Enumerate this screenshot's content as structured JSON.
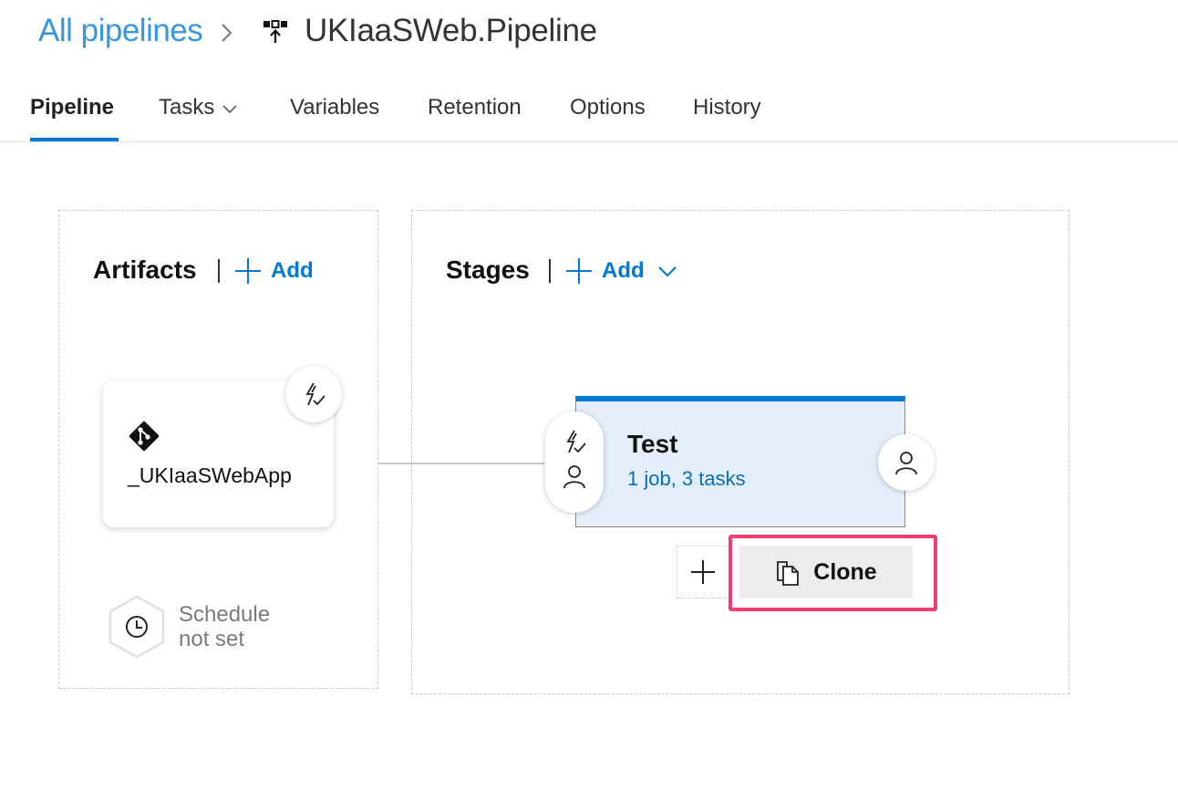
{
  "header": {
    "breadcrumb_root": "All pipelines",
    "pipeline_name": "UKIaaSWeb.Pipeline"
  },
  "tabs": [
    {
      "label": "Pipeline",
      "active": true
    },
    {
      "label": "Tasks",
      "dropdown": true
    },
    {
      "label": "Variables"
    },
    {
      "label": "Retention"
    },
    {
      "label": "Options"
    },
    {
      "label": "History"
    }
  ],
  "artifacts": {
    "title": "Artifacts",
    "add_label": "Add",
    "items": [
      {
        "name": "_UKIaaSWebApp",
        "icon": "git-icon"
      }
    ],
    "schedule": {
      "line1": "Schedule",
      "line2": "not set"
    }
  },
  "stages": {
    "title": "Stages",
    "add_label": "Add",
    "items": [
      {
        "name": "Test",
        "summary": "1 job, 3 tasks"
      }
    ],
    "clone_label": "Clone"
  },
  "colors": {
    "accent": "#0078d4",
    "link": "#3a96dd",
    "stage_bg": "#e3eef9",
    "highlight": "#f03e73"
  }
}
